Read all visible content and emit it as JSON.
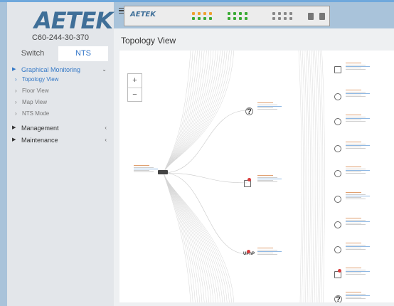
{
  "brand": {
    "logo_text": "AETEK",
    "device_logo": "AETEK"
  },
  "hostname": "C60-244-30-370",
  "tabs": [
    {
      "label": "Switch"
    },
    {
      "label": "NTS"
    }
  ],
  "menu": [
    {
      "label": "Graphical Monitoring",
      "active": true,
      "chevron": "⌄"
    },
    {
      "label": "Topology View",
      "active": true
    },
    {
      "label": "Floor View"
    },
    {
      "label": "Map View"
    },
    {
      "label": "NTS Mode"
    },
    {
      "label": "Management",
      "chevron": "‹"
    },
    {
      "label": "Maintenance",
      "chevron": "‹"
    }
  ],
  "page_title": "Topology View",
  "zoom": {
    "in": "+",
    "out": "−"
  },
  "icons": [
    "hamburger-icon",
    "zoom-in-icon",
    "zoom-out-icon",
    "unknown-device-icon",
    "router-icon",
    "switch-icon",
    "upnp-icon"
  ],
  "colors": {
    "accent": "#3478c6",
    "port_orange": "#f0a030",
    "port_green": "#3aaa35",
    "port_gray": "#888888",
    "status_red": "#d93c3c"
  }
}
